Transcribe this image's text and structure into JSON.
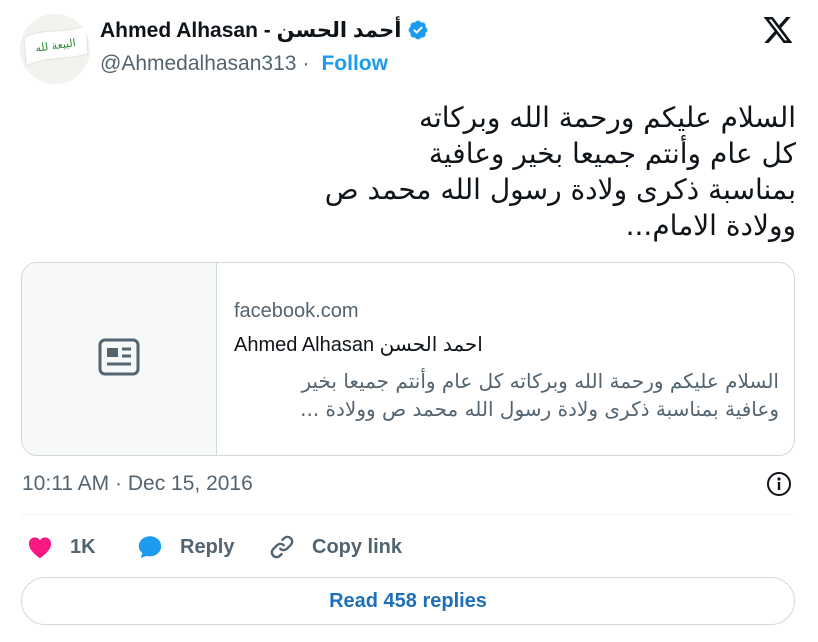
{
  "author": {
    "name": "Ahmed Alhasan - أحمد الحسن",
    "handle": "@Ahmedalhasan313",
    "follow_label": "Follow",
    "avatar_flag_text": "البيعة لله"
  },
  "tweet": {
    "lines": [
      "السلام عليكم ورحمة الله وبركاته",
      "كل عام وأنتم جميعا بخير وعافية",
      "بمناسبة ذكرى ولادة رسول الله محمد ص",
      "وولادة الامام..."
    ]
  },
  "card": {
    "domain": "facebook.com",
    "title": "Ahmed Alhasan احمد الحسن",
    "description_lines": [
      "السلام عليكم ورحمة الله وبركاته كل عام وأنتم جميعا بخير",
      "وعافية بمناسبة ذكرى ولادة رسول الله محمد ص وولادة ..."
    ],
    "thumbnail_icon": "article-icon"
  },
  "meta": {
    "time": "10:11 AM",
    "separator": "·",
    "date": "Dec 15, 2016"
  },
  "actions": {
    "like_count": "1K",
    "reply_label": "Reply",
    "copy_link_label": "Copy link"
  },
  "read_replies_label": "Read 458 replies",
  "colors": {
    "accent": "#1d9bf0",
    "like": "#f91880",
    "text": "#0f1419",
    "muted": "#536471",
    "border": "#cfd9de"
  },
  "icons": [
    "x-logo-icon",
    "verified-badge-icon",
    "info-icon",
    "heart-icon",
    "reply-bubble-icon",
    "link-icon",
    "article-icon"
  ]
}
